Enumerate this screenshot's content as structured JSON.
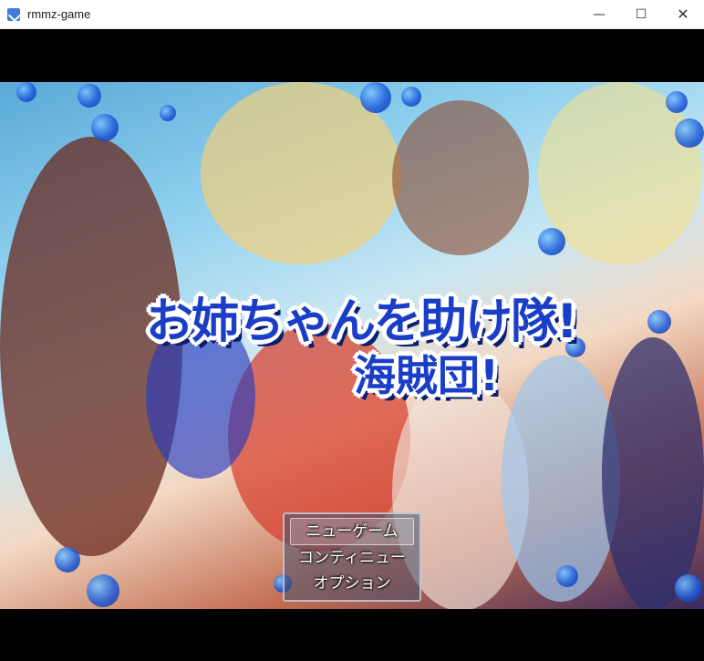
{
  "window": {
    "title": "rmmz-game",
    "minimize_glyph": "—",
    "maximize_glyph": "☐",
    "close_glyph": "✕"
  },
  "game": {
    "logo_line1": "お姉ちゃんを助け隊!",
    "logo_line2": "海賊団!"
  },
  "menu": {
    "items": [
      {
        "label": "ニューゲーム",
        "selected": true
      },
      {
        "label": "コンティニュー",
        "selected": false
      },
      {
        "label": "オプション",
        "selected": false
      }
    ]
  },
  "colors": {
    "logo_blue": "#1b3ec8",
    "letterbox": "#000000"
  },
  "icons": {
    "app": "rpgmaker-app-icon"
  }
}
